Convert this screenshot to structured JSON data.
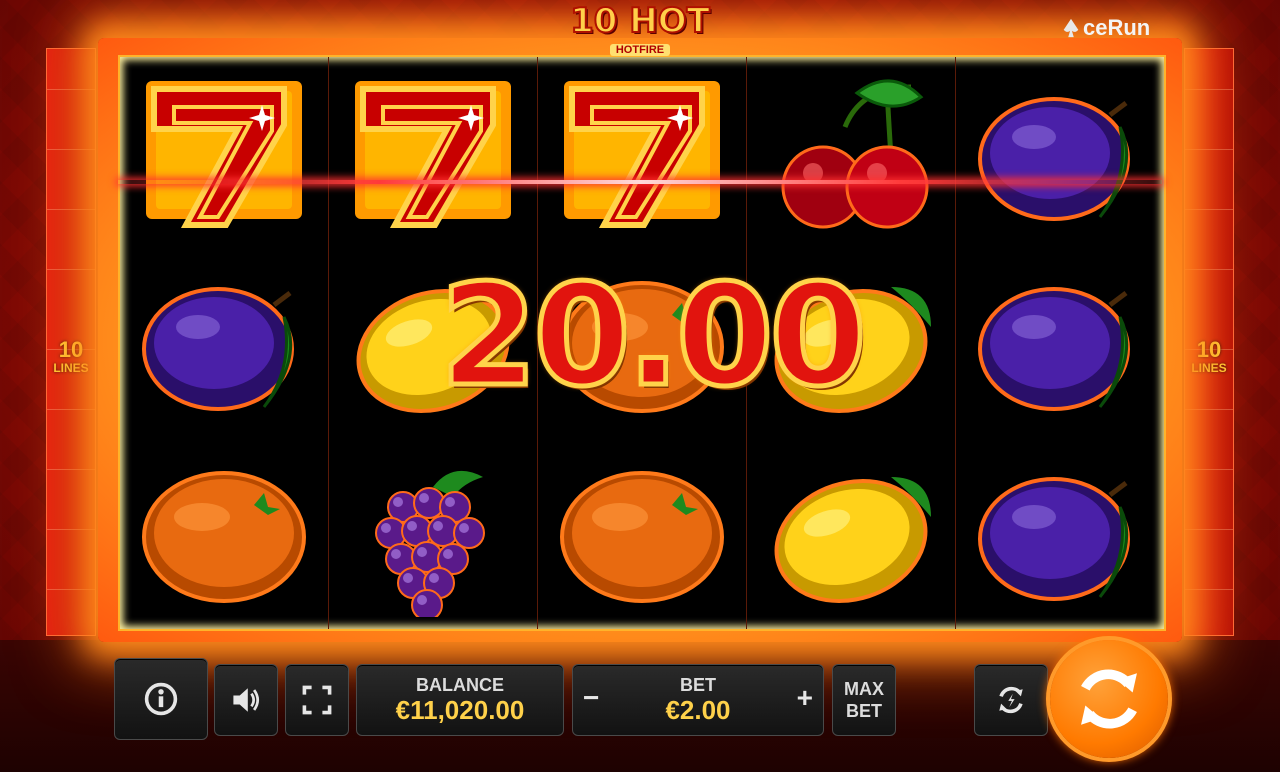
{
  "header": {
    "title": "10 HOT",
    "subtitle": "HOTFIRE",
    "brand": "ceRun",
    "brand_icon": "ace-spade-icon"
  },
  "side_panels": {
    "left_number": "10",
    "left_label": "LINES",
    "right_number": "10",
    "right_label": "LINES"
  },
  "reels": [
    [
      "seven",
      "plum",
      "orange"
    ],
    [
      "seven",
      "lemon",
      "grapes"
    ],
    [
      "seven",
      "orange",
      "orange"
    ],
    [
      "cherry",
      "lemon",
      "lemon"
    ],
    [
      "plum",
      "plum",
      "plum"
    ]
  ],
  "win": {
    "amount": "20.00"
  },
  "controls": {
    "info_icon": "info-icon",
    "sound_icon": "speaker-icon",
    "fullscreen_icon": "fullscreen-icon",
    "balance_label": "BALANCE",
    "balance_value": "€11,020.00",
    "bet_label": "BET",
    "bet_value": "€2.00",
    "bet_decrease": "−",
    "bet_increase": "+",
    "max_bet_line1": "MAX",
    "max_bet_line2": "BET",
    "autoplay_icon": "autoplay-icon",
    "spin_icon": "spin-arrows-icon"
  },
  "colors": {
    "accent": "#ff7a00",
    "value_gold": "#ffd14a",
    "win_red": "#e1140e"
  }
}
